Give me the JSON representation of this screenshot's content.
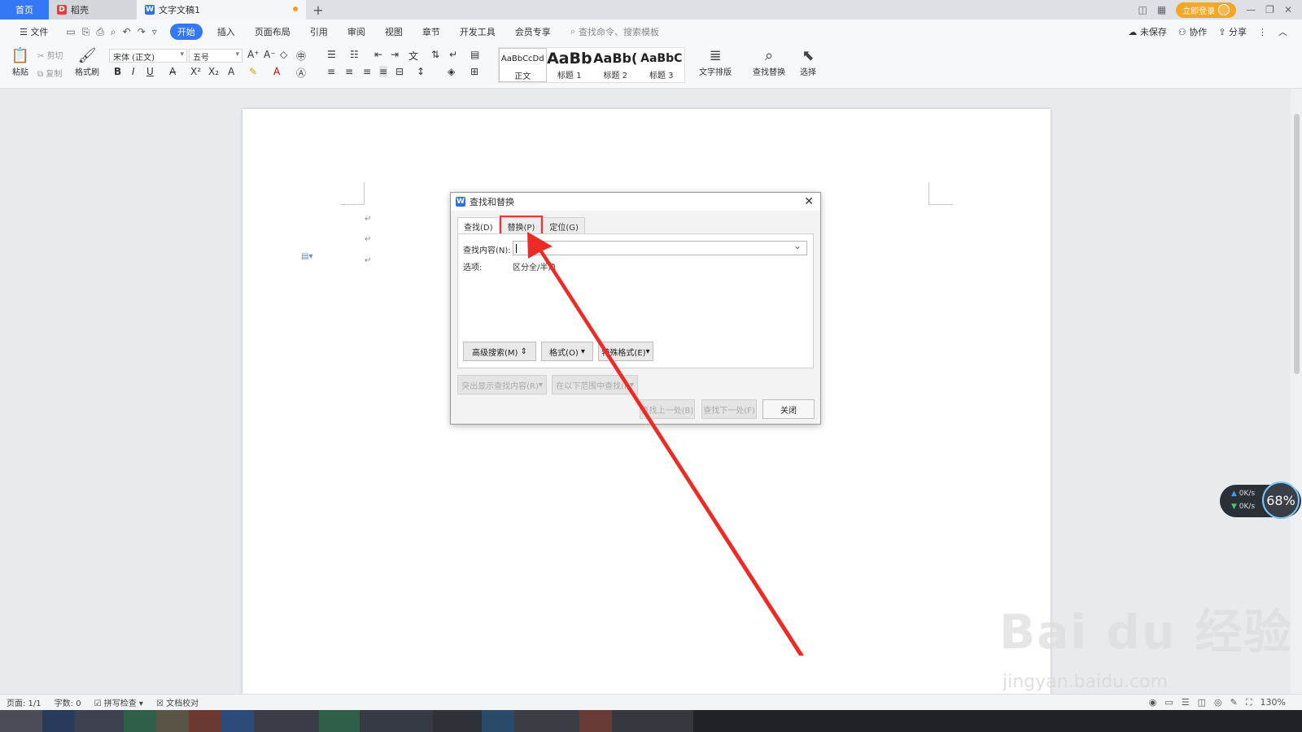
{
  "tabs": {
    "home": "首页",
    "daoke": "稻壳",
    "doc": "文字文稿1",
    "add": "+"
  },
  "titlebar": {
    "login": "立即登录"
  },
  "menu": {
    "file": "文件",
    "items": [
      "开始",
      "插入",
      "页面布局",
      "引用",
      "审阅",
      "视图",
      "章节",
      "开发工具",
      "会员专享"
    ],
    "search_placeholder": "查找命令、搜索模板",
    "unsaved": "未保存",
    "collab": "协作",
    "share": "分享"
  },
  "ribbon": {
    "paste": "粘贴",
    "cut": "剪切",
    "copy": "复制",
    "format_painter": "格式刷",
    "font_name": "宋体 (正文)",
    "font_size": "五号",
    "styles": [
      {
        "sample": "AaBbCcDd",
        "name": "正文"
      },
      {
        "sample": "AaBb",
        "name": "标题 1"
      },
      {
        "sample": "AaBb(",
        "name": "标题 2"
      },
      {
        "sample": "AaBbC",
        "name": "标题 3"
      }
    ],
    "text_layout": "文字排版",
    "find_replace": "查找替换",
    "select": "选择"
  },
  "dialog": {
    "title": "查找和替换",
    "tabs": {
      "find": "查找(D)",
      "replace": "替换(P)",
      "goto": "定位(G)"
    },
    "find_label": "查找内容(N):",
    "find_value": "",
    "options_label": "选项:",
    "options_value": "区分全/半角",
    "adv_search": "高级搜索(M)",
    "format": "格式(O)",
    "special": "特殊格式(E)",
    "highlight": "突出显示查找内容(R)",
    "find_in": "在以下范围中查找(I)",
    "find_prev": "查找上一处(B)",
    "find_next": "查找下一处(F)",
    "close": "关闭"
  },
  "netmeter": {
    "up": "0K/s",
    "down": "0K/s",
    "percent": "68%"
  },
  "status": {
    "page": "页面: 1/1",
    "words": "字数: 0",
    "spell": "拼写检查",
    "proof": "文档校对",
    "zoom": "130%"
  },
  "watermark": {
    "line1": "Bai du 经验",
    "line2": "jingyan.baidu.com"
  },
  "colors": {
    "accent": "#3478f6",
    "highlight_red": "#e53935",
    "login": "#f5a623"
  }
}
